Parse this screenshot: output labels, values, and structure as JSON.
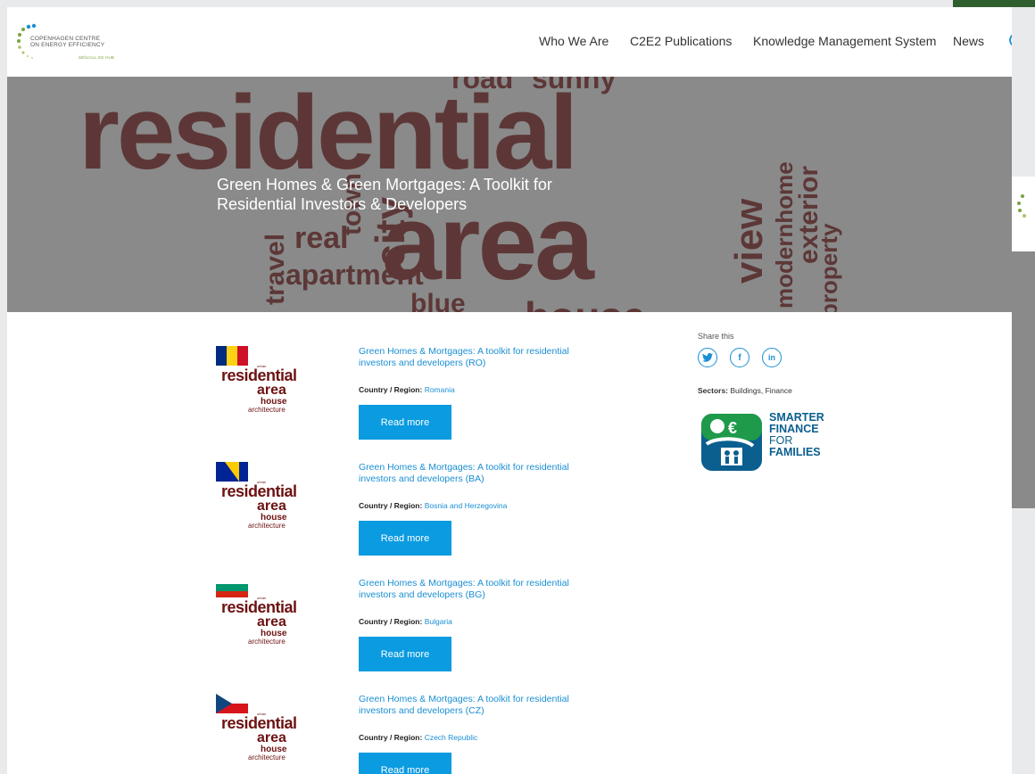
{
  "logo": {
    "line1": "COPENHAGEN CENTRE",
    "line2": "ON ENERGY EFFICIENCY",
    "sub": "SEforALL EE HUB"
  },
  "nav": [
    "Who We Are",
    "C2E2 Publications",
    "Knowledge Management System",
    "News"
  ],
  "hero": {
    "title": "Green Homes & Green Mortgages: A Toolkit for Residential Investors & Developers",
    "words": [
      "road",
      "sunny",
      "residential",
      "area",
      "real",
      "town",
      "city",
      "travel",
      "apartment",
      "blue",
      "view",
      "modernhome",
      "exterior",
      "property",
      "house"
    ]
  },
  "items": [
    {
      "title": "Green Homes & Mortgages: A toolkit for residential investors and developers (RO)",
      "country_label": "Country / Region:",
      "country": "Romania",
      "button": "Read more",
      "flag": "ro"
    },
    {
      "title": "Green Homes & Mortgages: A toolkit for residential investors and developers (BA)",
      "country_label": "Country / Region:",
      "country": "Bosnia and Herzegovina",
      "button": "Read more",
      "flag": "ba"
    },
    {
      "title": "Green Homes & Mortgages: A toolkit for residential investors and developers (BG)",
      "country_label": "Country / Region:",
      "country": "Bulgaria",
      "button": "Read more",
      "flag": "bg"
    },
    {
      "title": "Green Homes & Mortgages: A toolkit for residential investors and developers (CZ)",
      "country_label": "Country / Region:",
      "country": "Czech Republic",
      "button": "Read more",
      "flag": "cz"
    }
  ],
  "thumb_words": {
    "w1": "residential",
    "w2": "area",
    "w3": "house",
    "w4": "architecture",
    "w5": "urban"
  },
  "sidebar": {
    "share_label": "Share this",
    "share_icons": [
      "twitter-icon",
      "facebook-icon",
      "linkedin-icon"
    ],
    "sectors_label": "Sectors:",
    "sectors_value": "Buildings, Finance",
    "sff": {
      "line1": "SMARTER",
      "line2": "FINANCE",
      "line3": "FOR",
      "line4": "FAMILIES"
    }
  },
  "colors": {
    "link": "#1a8fd4",
    "button": "#0a9be1",
    "brand_green": "#7aa33d",
    "sff_blue": "#0a5f8f",
    "sff_green": "#1e9a4a"
  }
}
